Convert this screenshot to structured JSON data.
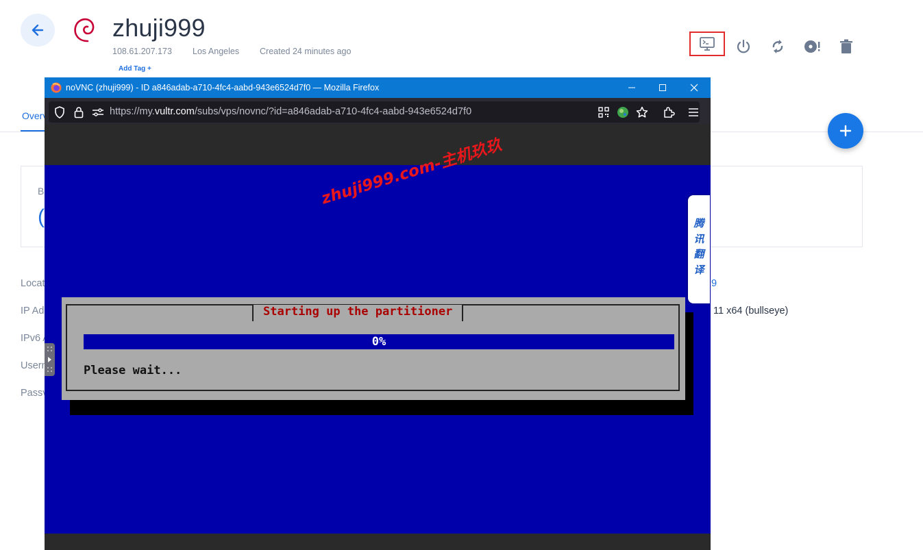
{
  "server": {
    "name": "zhuji999",
    "ip": "108.61.207.173",
    "location": "Los Angeles",
    "created": "Created 24 minutes ago",
    "add_tag": "Add Tag +"
  },
  "icons": {
    "back": "arrow-left-icon",
    "os": "debian-logo",
    "console": "console-icon",
    "power": "power-icon",
    "restart": "restart-icon",
    "reinstall": "reinstall-icon",
    "destroy": "trash-icon",
    "add": "plus-icon"
  },
  "tabs": {
    "overview_partial": "Overv"
  },
  "card": {
    "label_partial": "B",
    "value_partial": "("
  },
  "info": {
    "labels_partial": [
      "Locat",
      "IP Ad",
      "IPv6 A",
      "Usern",
      "Passv"
    ],
    "right_values_partial": [
      "9",
      "11 x64 (bullseye)"
    ]
  },
  "firefox": {
    "title": "noVNC (zhuji999) - ID a846adab-a710-4fc4-aabd-943e6524d7f0 — Mozilla Firefox",
    "url_prefix": "https://my.",
    "url_domain": "vultr.com",
    "url_path": "/subs/vps/novnc/?id=a846adab-a710-4fc4-aabd-943e6524d7f0"
  },
  "installer": {
    "title": "Starting up the partitioner",
    "progress_label": "0%",
    "progress": 0,
    "message": "Please wait..."
  },
  "watermark": "zhuji999.com-主机玖玖",
  "translate_tab": "腾讯翻译",
  "colors": {
    "accent": "#1e6fe0",
    "console_highlight": "#e12b2b",
    "vnc_background": "#0000aa",
    "dialog_title": "#aa0000",
    "firefox_titlebar": "#0b78d4"
  }
}
